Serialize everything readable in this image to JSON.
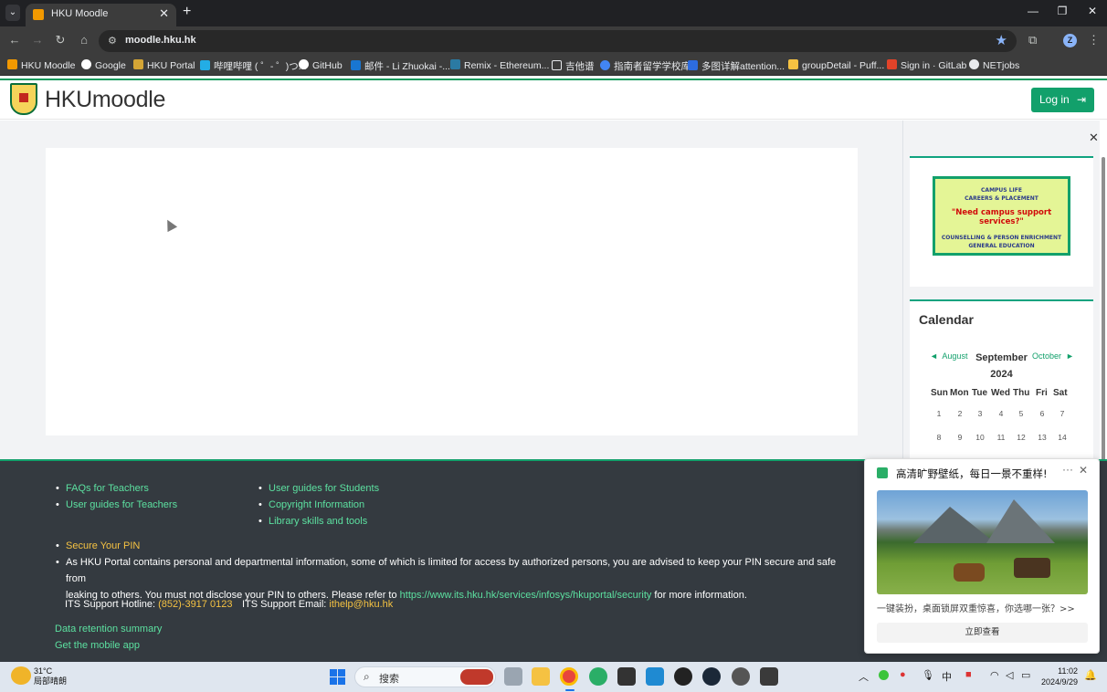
{
  "browser": {
    "tab_title": "HKU Moodle",
    "url": "moodle.hku.hk",
    "profile_initial": "Z",
    "bookmarks": [
      "HKU Moodle",
      "Google",
      "HKU Portal",
      "哔哩哔哩 ( ゜- ゜)つ...",
      "GitHub",
      "邮件 - Li Zhuokai -...",
      "Remix - Ethereum...",
      "吉他谱",
      "指南者留学学校库",
      "多图详解attention...",
      "groupDetail - Puff...",
      "Sign in · GitLab",
      "NETjobs"
    ]
  },
  "header": {
    "logo_text": "HKUmoodle",
    "login_label": "Log in"
  },
  "drawer": {
    "banner": {
      "line1": "CAMPUS LIFE",
      "line2": "CAREERS & PLACEMENT",
      "line3": "\"Need campus support services?\"",
      "line4": "COUNSELLING & PERSON ENRICHMENT",
      "line5": "GENERAL EDUCATION"
    },
    "calendar": {
      "title": "Calendar",
      "prev": "August",
      "next": "October",
      "month": "September",
      "year": "2024",
      "weekdays": [
        "Sun",
        "Mon",
        "Tue",
        "Wed",
        "Thu",
        "Fri",
        "Sat"
      ],
      "weeks": [
        [
          "1",
          "2",
          "3",
          "4",
          "5",
          "6",
          "7"
        ],
        [
          "8",
          "9",
          "10",
          "11",
          "12",
          "13",
          "14"
        ]
      ]
    }
  },
  "footer": {
    "col1": [
      "FAQs for Teachers",
      "User guides for Teachers"
    ],
    "col2": [
      "User guides for Students",
      "Copyright Information",
      "Library skills and tools"
    ],
    "pin_heading": "Secure Your PIN",
    "pin_text_1": "As HKU Portal contains personal and departmental information, some of which is limited for access by authorized persons, you are advised to keep your PIN secure and safe from",
    "pin_text_2a": "leaking to others. You must not disclose your PIN to others. Please refer to ",
    "pin_link": "https://www.its.hku.hk/services/infosys/hkuportal/security",
    "pin_text_2b": " for more information.",
    "hotline_label": "ITS Support Hotline: ",
    "hotline_value": "(852)-3917 0123",
    "email_label": "ITS Support Email: ",
    "email_value": "ithelp@hku.hk",
    "data_retention": "Data retention summary",
    "mobile_app": "Get the mobile app"
  },
  "popup": {
    "title": "高清旷野壁纸，每日一景不重样!",
    "subtitle": "一键装扮，桌面锁屏双重惊喜，你选哪一张？>>",
    "button": "立即查看"
  },
  "taskbar": {
    "weather_temp": "31°C",
    "weather_desc": "局部晴朗",
    "search_label": "搜索",
    "ime": "中",
    "time": "11:02",
    "date": "2024/9/29"
  }
}
